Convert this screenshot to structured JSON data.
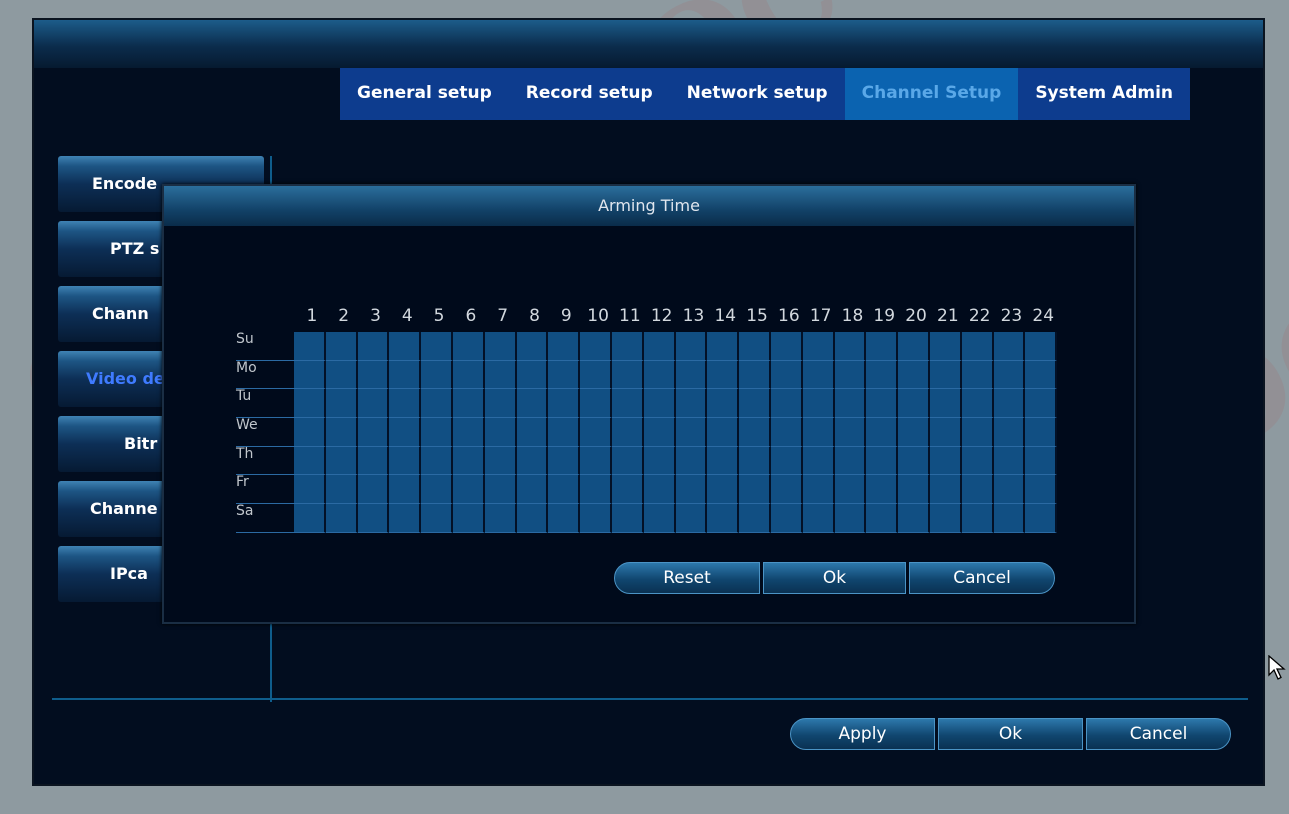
{
  "tabs": [
    "General setup",
    "Record setup",
    "Network setup",
    "Channel Setup",
    "System Admin"
  ],
  "active_tab": "Channel Setup",
  "sidebar": {
    "items": [
      "Encode",
      "PTZ s",
      "Chann",
      "Video de",
      "Bitr",
      "Channe",
      "IPca"
    ],
    "active_item": "Video de"
  },
  "dialog": {
    "title": "Arming Time",
    "hours": [
      "1",
      "2",
      "3",
      "4",
      "5",
      "6",
      "7",
      "8",
      "9",
      "10",
      "11",
      "12",
      "13",
      "14",
      "15",
      "16",
      "17",
      "18",
      "19",
      "20",
      "21",
      "22",
      "23",
      "24"
    ],
    "days": [
      "Su",
      "Mo",
      "Tu",
      "We",
      "Th",
      "Fr",
      "Sa"
    ],
    "buttons": {
      "reset": "Reset",
      "ok": "Ok",
      "cancel": "Cancel"
    }
  },
  "footer_buttons": {
    "apply": "Apply",
    "ok": "Ok",
    "cancel": "Cancel"
  },
  "colors": {
    "background": "#020d1f",
    "tab_bar": "#0d3c8e",
    "active_tab": "#0b63b0",
    "grid_cell": "#114f83",
    "active_sidebar_text": "#3f7bff"
  }
}
